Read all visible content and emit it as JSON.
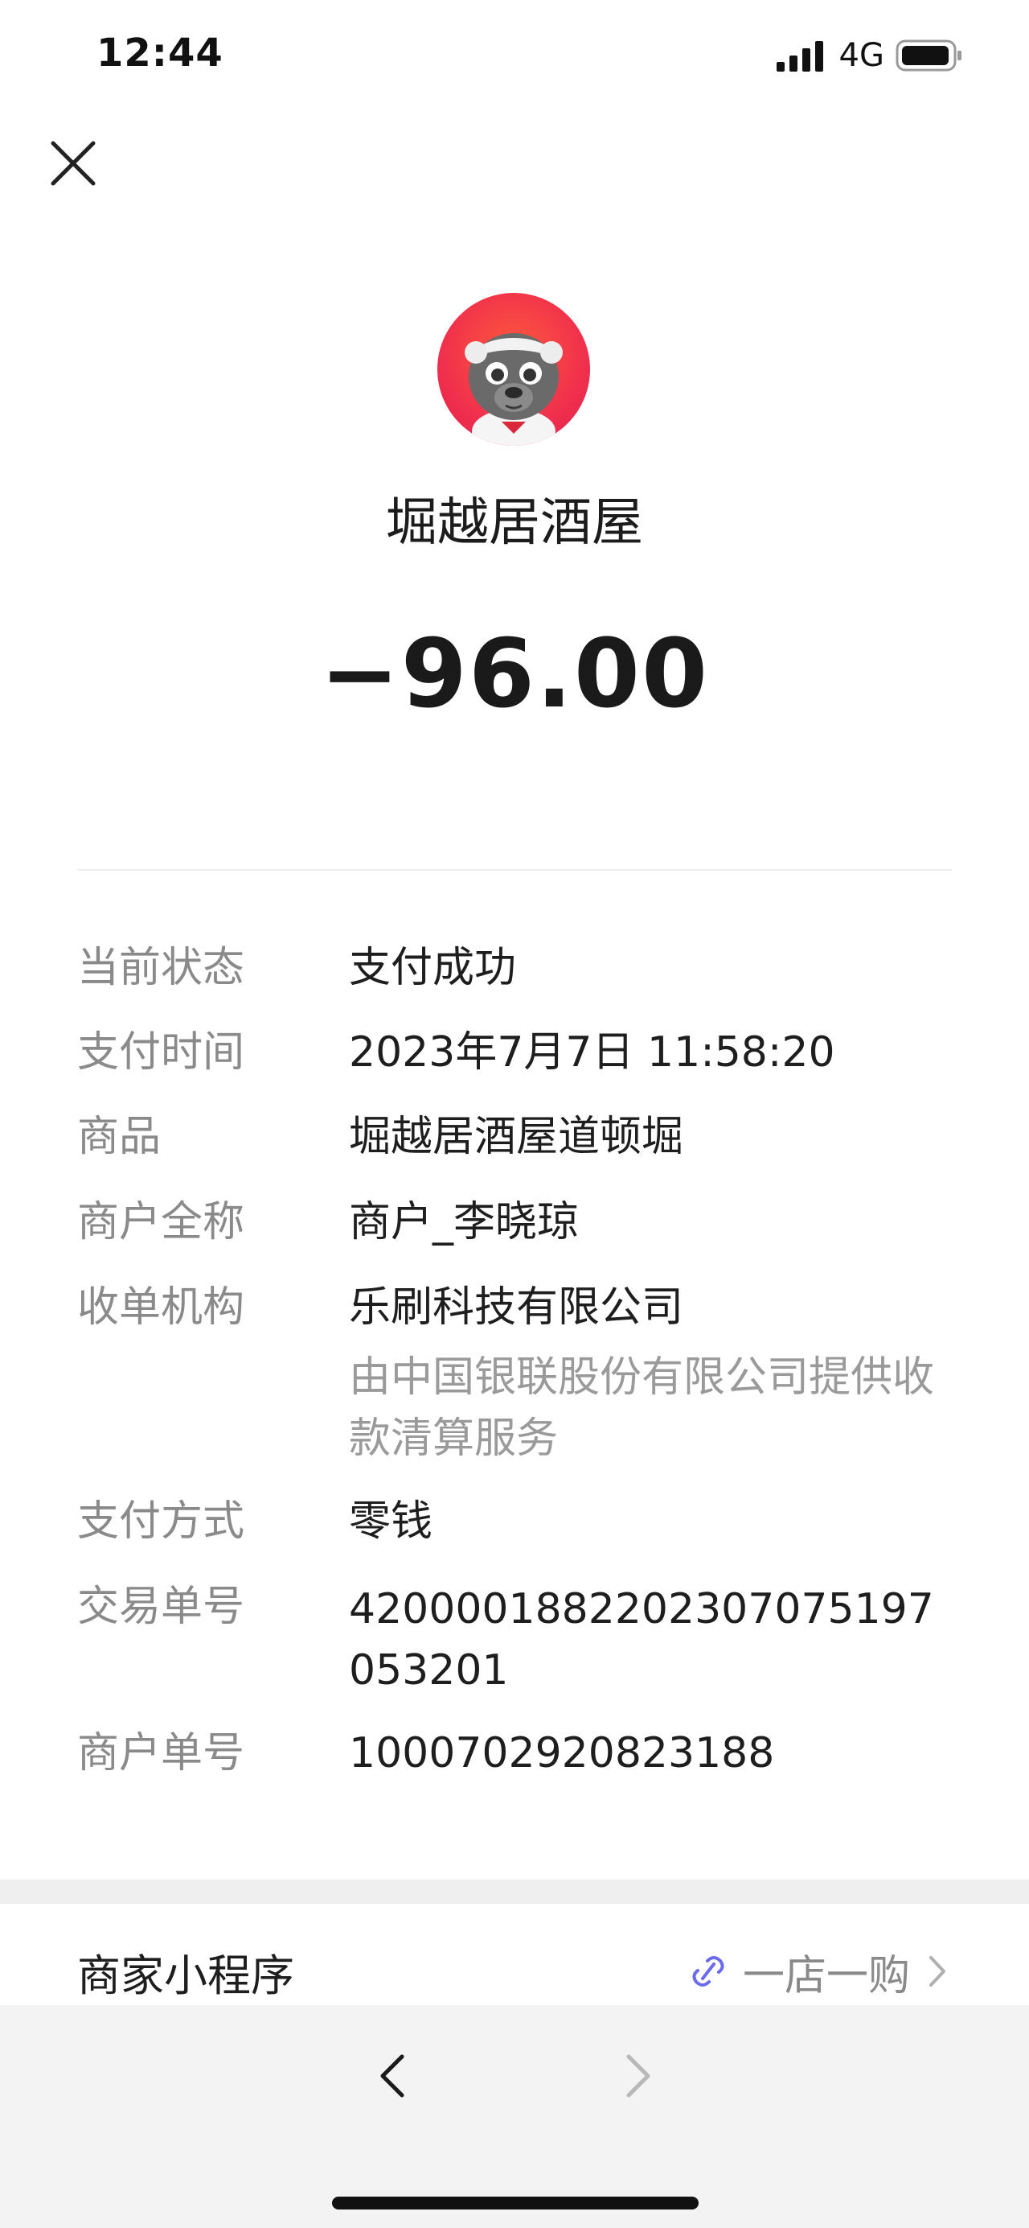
{
  "status_bar": {
    "time": "12:44",
    "network": "4G"
  },
  "merchant": {
    "name": "堀越居酒屋",
    "amount": "−96.00"
  },
  "details": [
    {
      "label": "当前状态",
      "value": "支付成功"
    },
    {
      "label": "支付时间",
      "value": "2023年7月7日 11:58:20"
    },
    {
      "label": "商品",
      "value": "堀越居酒屋道顿堀"
    },
    {
      "label": "商户全称",
      "value": "商户_李晓琼"
    },
    {
      "label": "收单机构",
      "value": "乐刷科技有限公司",
      "note": "由中国银联股份有限公司提供收款清算服务"
    },
    {
      "label": "支付方式",
      "value": "零钱"
    },
    {
      "label": "交易单号",
      "value": "4200001882202307075197053201"
    },
    {
      "label": "商户单号",
      "value": "1000702920823188"
    }
  ],
  "mini_program": {
    "label": "商家小程序",
    "value": "一店一购"
  },
  "colors": {
    "link_icon": "#6b6bf0",
    "avatar_bg": "#f0304c",
    "divider": "#ececec"
  }
}
